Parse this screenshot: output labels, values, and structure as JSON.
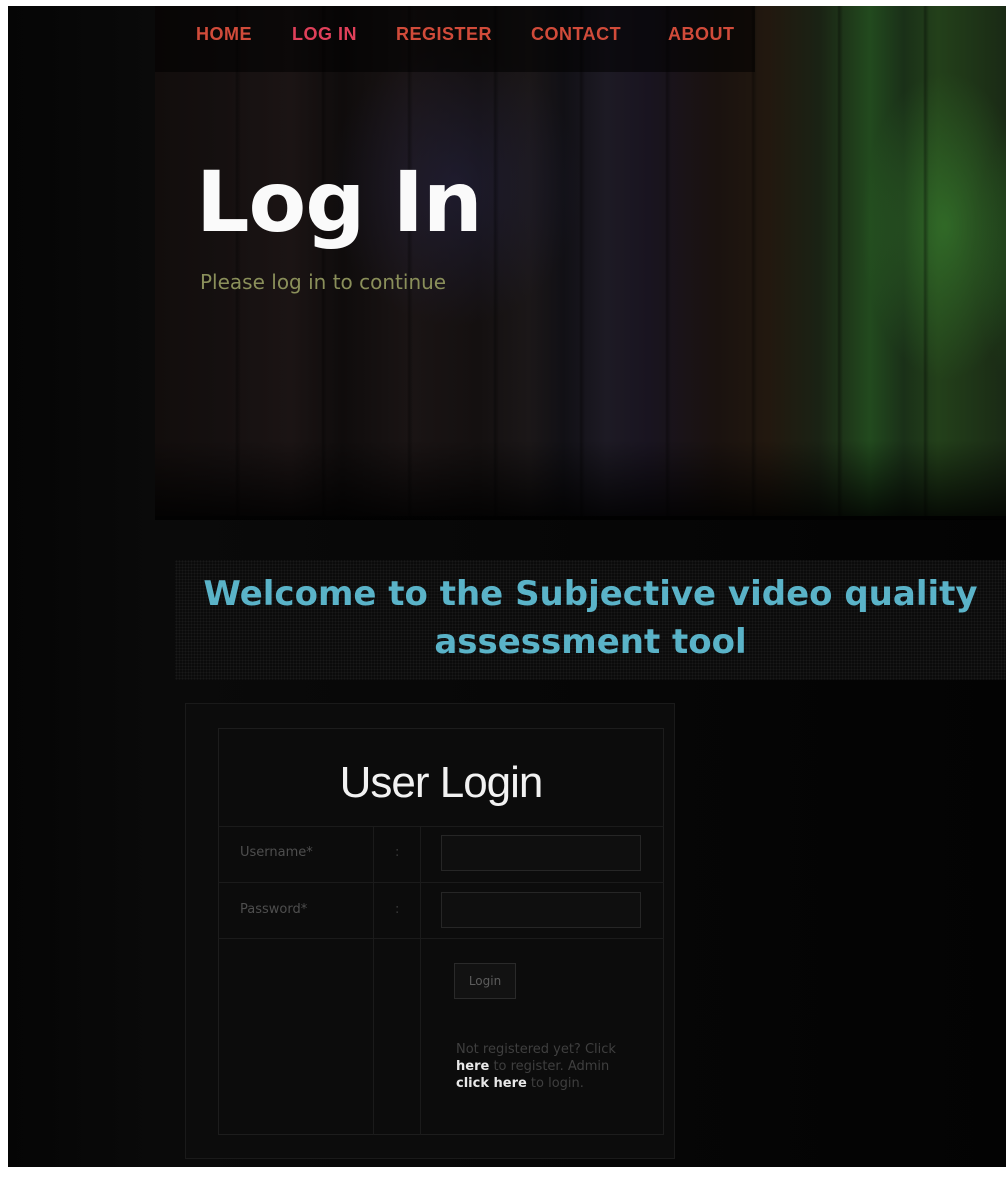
{
  "nav": {
    "items": [
      {
        "label": "HOME"
      },
      {
        "label": "LOG IN"
      },
      {
        "label": "REGISTER"
      },
      {
        "label": "CONTACT"
      },
      {
        "label": "ABOUT"
      }
    ]
  },
  "hero": {
    "title": "Log In",
    "subtitle": "Please log in to continue"
  },
  "welcome": {
    "line1": "Welcome to the Subjective video quality",
    "line2": "assessment tool"
  },
  "login": {
    "title": "User Login",
    "username_label": "Username*",
    "password_label": "Password*",
    "separator": ":",
    "username_value": "",
    "password_value": "",
    "button_label": "Login",
    "help": {
      "part1": "Not registered yet? Click ",
      "link1": "here",
      "part2": " to register. Admin ",
      "link2": "click here",
      "part3": " to login."
    }
  },
  "colors": {
    "nav_text": "#d14b3a",
    "welcome_text": "#5ab3c8",
    "subtitle_text": "#8a8f5a"
  }
}
